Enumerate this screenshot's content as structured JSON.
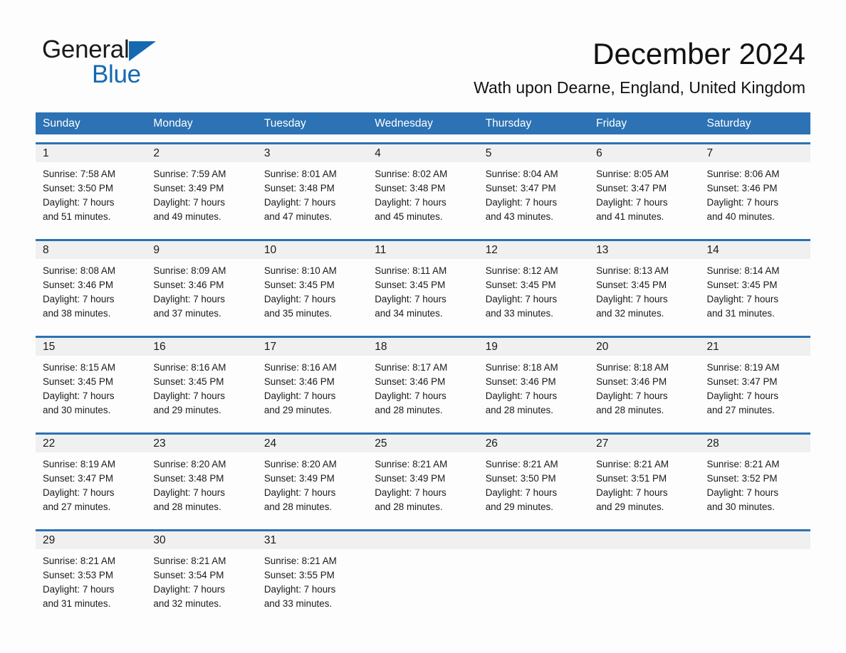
{
  "brand": {
    "name_part1": "General",
    "name_part2": "Blue",
    "triangle_color": "#1569b0",
    "logo_icon": "triangle-icon"
  },
  "header": {
    "title": "December 2024",
    "subtitle": "Wath upon Dearne, England, United Kingdom"
  },
  "theme": {
    "header_blue": "#2c72b4",
    "daynum_gray": "#f0f0f0",
    "page_background": "#fdfdfd",
    "text": "#1a1a1a"
  },
  "calendar": {
    "weekday_headers": [
      "Sunday",
      "Monday",
      "Tuesday",
      "Wednesday",
      "Thursday",
      "Friday",
      "Saturday"
    ],
    "labels": {
      "sunrise": "Sunrise:",
      "sunset": "Sunset:",
      "daylight": "Daylight:"
    },
    "weeks": [
      [
        {
          "day": "1",
          "sunrise": "Sunrise: 7:58 AM",
          "sunset": "Sunset: 3:50 PM",
          "daylight_line1": "Daylight: 7 hours",
          "daylight_line2": "and 51 minutes."
        },
        {
          "day": "2",
          "sunrise": "Sunrise: 7:59 AM",
          "sunset": "Sunset: 3:49 PM",
          "daylight_line1": "Daylight: 7 hours",
          "daylight_line2": "and 49 minutes."
        },
        {
          "day": "3",
          "sunrise": "Sunrise: 8:01 AM",
          "sunset": "Sunset: 3:48 PM",
          "daylight_line1": "Daylight: 7 hours",
          "daylight_line2": "and 47 minutes."
        },
        {
          "day": "4",
          "sunrise": "Sunrise: 8:02 AM",
          "sunset": "Sunset: 3:48 PM",
          "daylight_line1": "Daylight: 7 hours",
          "daylight_line2": "and 45 minutes."
        },
        {
          "day": "5",
          "sunrise": "Sunrise: 8:04 AM",
          "sunset": "Sunset: 3:47 PM",
          "daylight_line1": "Daylight: 7 hours",
          "daylight_line2": "and 43 minutes."
        },
        {
          "day": "6",
          "sunrise": "Sunrise: 8:05 AM",
          "sunset": "Sunset: 3:47 PM",
          "daylight_line1": "Daylight: 7 hours",
          "daylight_line2": "and 41 minutes."
        },
        {
          "day": "7",
          "sunrise": "Sunrise: 8:06 AM",
          "sunset": "Sunset: 3:46 PM",
          "daylight_line1": "Daylight: 7 hours",
          "daylight_line2": "and 40 minutes."
        }
      ],
      [
        {
          "day": "8",
          "sunrise": "Sunrise: 8:08 AM",
          "sunset": "Sunset: 3:46 PM",
          "daylight_line1": "Daylight: 7 hours",
          "daylight_line2": "and 38 minutes."
        },
        {
          "day": "9",
          "sunrise": "Sunrise: 8:09 AM",
          "sunset": "Sunset: 3:46 PM",
          "daylight_line1": "Daylight: 7 hours",
          "daylight_line2": "and 37 minutes."
        },
        {
          "day": "10",
          "sunrise": "Sunrise: 8:10 AM",
          "sunset": "Sunset: 3:45 PM",
          "daylight_line1": "Daylight: 7 hours",
          "daylight_line2": "and 35 minutes."
        },
        {
          "day": "11",
          "sunrise": "Sunrise: 8:11 AM",
          "sunset": "Sunset: 3:45 PM",
          "daylight_line1": "Daylight: 7 hours",
          "daylight_line2": "and 34 minutes."
        },
        {
          "day": "12",
          "sunrise": "Sunrise: 8:12 AM",
          "sunset": "Sunset: 3:45 PM",
          "daylight_line1": "Daylight: 7 hours",
          "daylight_line2": "and 33 minutes."
        },
        {
          "day": "13",
          "sunrise": "Sunrise: 8:13 AM",
          "sunset": "Sunset: 3:45 PM",
          "daylight_line1": "Daylight: 7 hours",
          "daylight_line2": "and 32 minutes."
        },
        {
          "day": "14",
          "sunrise": "Sunrise: 8:14 AM",
          "sunset": "Sunset: 3:45 PM",
          "daylight_line1": "Daylight: 7 hours",
          "daylight_line2": "and 31 minutes."
        }
      ],
      [
        {
          "day": "15",
          "sunrise": "Sunrise: 8:15 AM",
          "sunset": "Sunset: 3:45 PM",
          "daylight_line1": "Daylight: 7 hours",
          "daylight_line2": "and 30 minutes."
        },
        {
          "day": "16",
          "sunrise": "Sunrise: 8:16 AM",
          "sunset": "Sunset: 3:45 PM",
          "daylight_line1": "Daylight: 7 hours",
          "daylight_line2": "and 29 minutes."
        },
        {
          "day": "17",
          "sunrise": "Sunrise: 8:16 AM",
          "sunset": "Sunset: 3:46 PM",
          "daylight_line1": "Daylight: 7 hours",
          "daylight_line2": "and 29 minutes."
        },
        {
          "day": "18",
          "sunrise": "Sunrise: 8:17 AM",
          "sunset": "Sunset: 3:46 PM",
          "daylight_line1": "Daylight: 7 hours",
          "daylight_line2": "and 28 minutes."
        },
        {
          "day": "19",
          "sunrise": "Sunrise: 8:18 AM",
          "sunset": "Sunset: 3:46 PM",
          "daylight_line1": "Daylight: 7 hours",
          "daylight_line2": "and 28 minutes."
        },
        {
          "day": "20",
          "sunrise": "Sunrise: 8:18 AM",
          "sunset": "Sunset: 3:46 PM",
          "daylight_line1": "Daylight: 7 hours",
          "daylight_line2": "and 28 minutes."
        },
        {
          "day": "21",
          "sunrise": "Sunrise: 8:19 AM",
          "sunset": "Sunset: 3:47 PM",
          "daylight_line1": "Daylight: 7 hours",
          "daylight_line2": "and 27 minutes."
        }
      ],
      [
        {
          "day": "22",
          "sunrise": "Sunrise: 8:19 AM",
          "sunset": "Sunset: 3:47 PM",
          "daylight_line1": "Daylight: 7 hours",
          "daylight_line2": "and 27 minutes."
        },
        {
          "day": "23",
          "sunrise": "Sunrise: 8:20 AM",
          "sunset": "Sunset: 3:48 PM",
          "daylight_line1": "Daylight: 7 hours",
          "daylight_line2": "and 28 minutes."
        },
        {
          "day": "24",
          "sunrise": "Sunrise: 8:20 AM",
          "sunset": "Sunset: 3:49 PM",
          "daylight_line1": "Daylight: 7 hours",
          "daylight_line2": "and 28 minutes."
        },
        {
          "day": "25",
          "sunrise": "Sunrise: 8:21 AM",
          "sunset": "Sunset: 3:49 PM",
          "daylight_line1": "Daylight: 7 hours",
          "daylight_line2": "and 28 minutes."
        },
        {
          "day": "26",
          "sunrise": "Sunrise: 8:21 AM",
          "sunset": "Sunset: 3:50 PM",
          "daylight_line1": "Daylight: 7 hours",
          "daylight_line2": "and 29 minutes."
        },
        {
          "day": "27",
          "sunrise": "Sunrise: 8:21 AM",
          "sunset": "Sunset: 3:51 PM",
          "daylight_line1": "Daylight: 7 hours",
          "daylight_line2": "and 29 minutes."
        },
        {
          "day": "28",
          "sunrise": "Sunrise: 8:21 AM",
          "sunset": "Sunset: 3:52 PM",
          "daylight_line1": "Daylight: 7 hours",
          "daylight_line2": "and 30 minutes."
        }
      ],
      [
        {
          "day": "29",
          "sunrise": "Sunrise: 8:21 AM",
          "sunset": "Sunset: 3:53 PM",
          "daylight_line1": "Daylight: 7 hours",
          "daylight_line2": "and 31 minutes."
        },
        {
          "day": "30",
          "sunrise": "Sunrise: 8:21 AM",
          "sunset": "Sunset: 3:54 PM",
          "daylight_line1": "Daylight: 7 hours",
          "daylight_line2": "and 32 minutes."
        },
        {
          "day": "31",
          "sunrise": "Sunrise: 8:21 AM",
          "sunset": "Sunset: 3:55 PM",
          "daylight_line1": "Daylight: 7 hours",
          "daylight_line2": "and 33 minutes."
        },
        {
          "day": "",
          "sunrise": "",
          "sunset": "",
          "daylight_line1": "",
          "daylight_line2": ""
        },
        {
          "day": "",
          "sunrise": "",
          "sunset": "",
          "daylight_line1": "",
          "daylight_line2": ""
        },
        {
          "day": "",
          "sunrise": "",
          "sunset": "",
          "daylight_line1": "",
          "daylight_line2": ""
        },
        {
          "day": "",
          "sunrise": "",
          "sunset": "",
          "daylight_line1": "",
          "daylight_line2": ""
        }
      ]
    ]
  }
}
